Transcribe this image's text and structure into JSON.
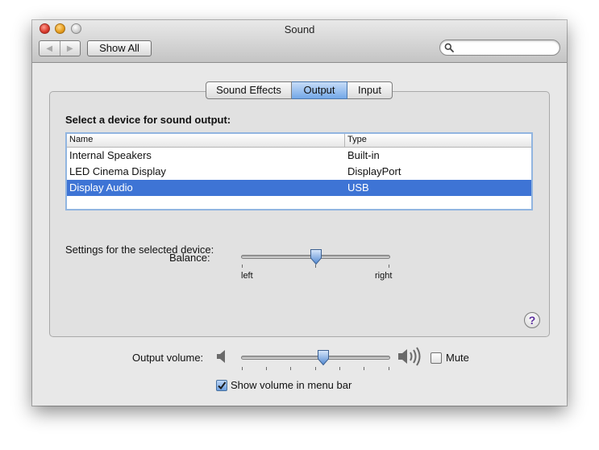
{
  "window": {
    "title": "Sound"
  },
  "toolbar": {
    "back_icon": "back-arrow-icon",
    "forward_icon": "forward-arrow-icon",
    "show_all_label": "Show All",
    "search_value": "",
    "search_placeholder": ""
  },
  "tabs": [
    {
      "label": "Sound Effects",
      "selected": false
    },
    {
      "label": "Output",
      "selected": true
    },
    {
      "label": "Input",
      "selected": false
    }
  ],
  "output": {
    "section_label": "Select a device for sound output:",
    "columns": [
      "Name",
      "Type"
    ],
    "devices": [
      {
        "name": "Internal Speakers",
        "type": "Built-in",
        "selected": false
      },
      {
        "name": "LED Cinema Display",
        "type": "DisplayPort",
        "selected": false
      },
      {
        "name": "Display Audio",
        "type": "USB",
        "selected": true
      }
    ],
    "settings_label": "Settings for the selected device:",
    "balance": {
      "label": "Balance:",
      "left_label": "left",
      "right_label": "right",
      "value": 0.5
    }
  },
  "help": {
    "label": "?"
  },
  "volume": {
    "label": "Output volume:",
    "value": 0.55,
    "low_icon": "speaker-low-icon",
    "high_icon": "speaker-high-icon",
    "mute_label": "Mute",
    "mute_checked": false,
    "show_in_menu_bar_label": "Show volume in menu bar",
    "show_in_menu_bar_checked": true
  },
  "colors": {
    "selection": "#3e74d5",
    "tab_selected": "#74a8e8",
    "window_background": "#e8e8e8"
  }
}
